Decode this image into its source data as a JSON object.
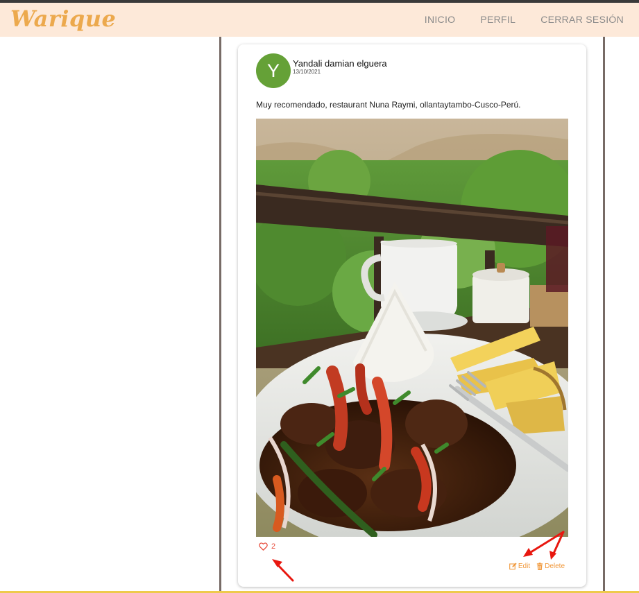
{
  "brand": "Warique",
  "nav": {
    "inicio": "INICIO",
    "perfil": "PERFIL",
    "logout": "CERRAR SESIÓN"
  },
  "post": {
    "avatar_initial": "Y",
    "author": "Yandali damian elguera",
    "date": "13/10/2021",
    "caption": "Muy recomendado, restaurant Nuna Raymi, ollantaytambo-Cusco-Perú.",
    "likes": "2",
    "edit_label": "Edit",
    "delete_label": "Delete"
  },
  "colors": {
    "navbar_bg": "#fde9d9",
    "brand": "#eca94d",
    "avatar": "#65a137",
    "like": "#e74c3c",
    "action": "#f19a3e",
    "annotation_arrow": "#e8170f"
  },
  "icons": {
    "like": "heart-outline-icon",
    "edit": "edit-icon",
    "delete": "trash-icon"
  }
}
